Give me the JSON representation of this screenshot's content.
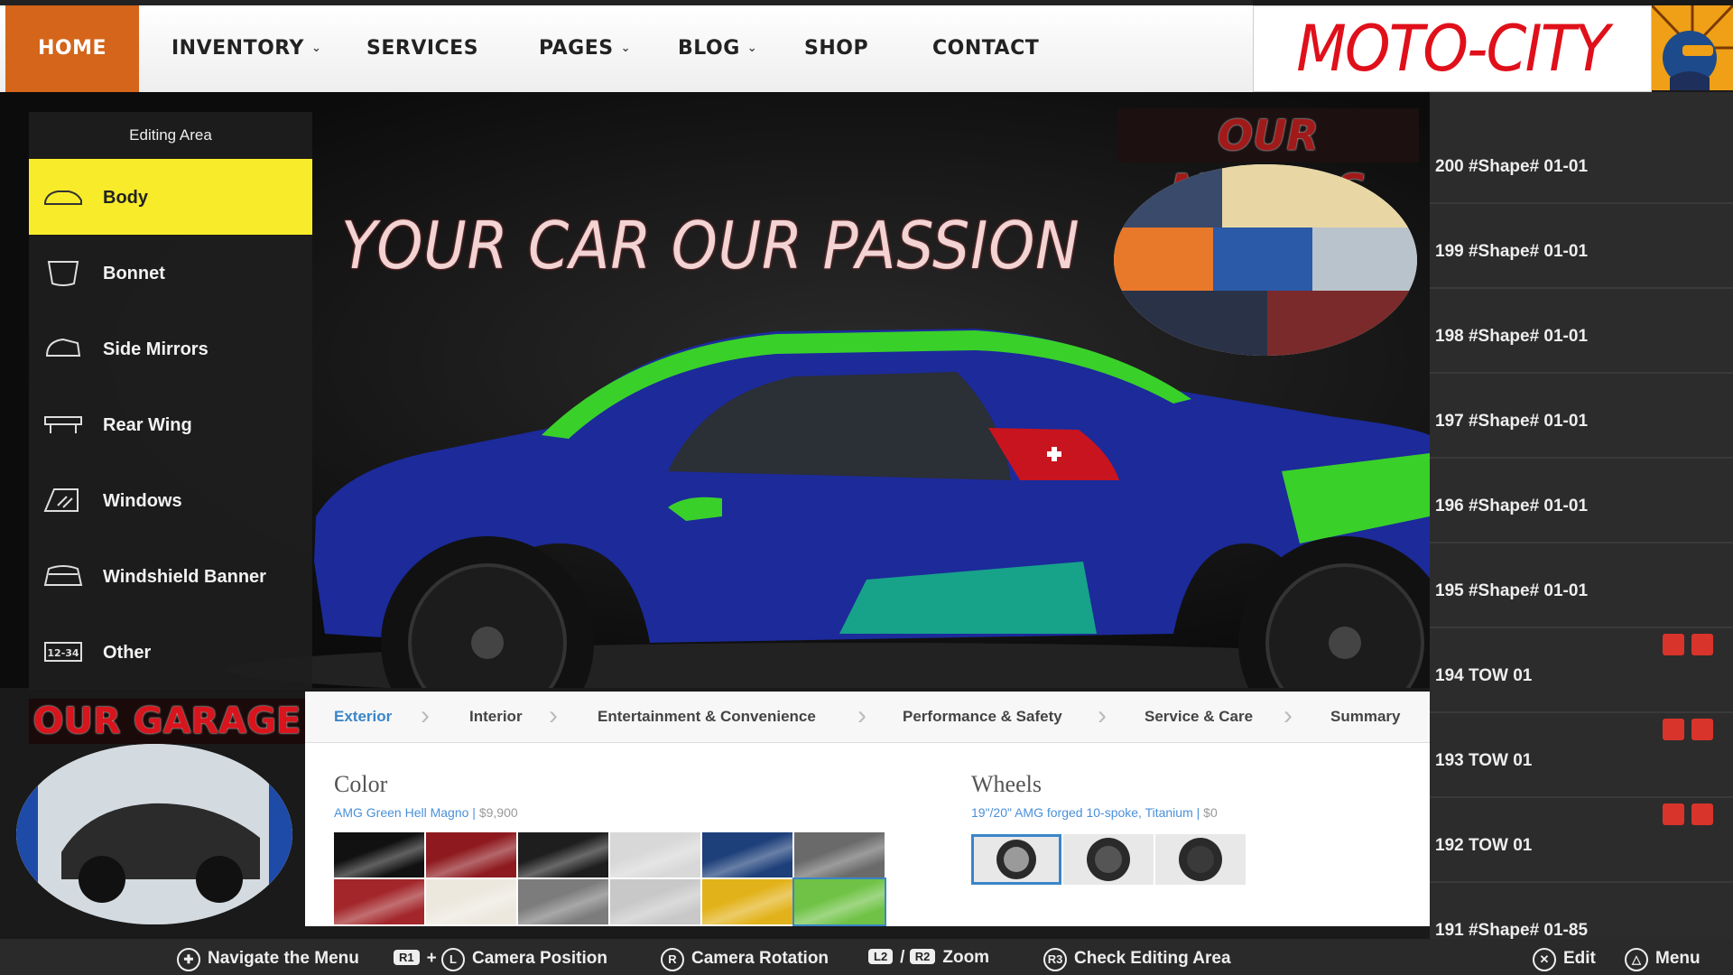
{
  "nav": {
    "items": [
      {
        "label": "HOME",
        "dropdown": false
      },
      {
        "label": "INVENTORY",
        "dropdown": true
      },
      {
        "label": "SERVICES",
        "dropdown": false
      },
      {
        "label": "PAGES",
        "dropdown": true
      },
      {
        "label": "BLOG",
        "dropdown": true
      },
      {
        "label": "SHOP",
        "dropdown": false
      },
      {
        "label": "CONTACT",
        "dropdown": false
      }
    ],
    "active": "HOME"
  },
  "brand": {
    "logo_text": "MOTO-CITY",
    "accent": "#d4651a",
    "logo_color": "#e0101a"
  },
  "hero": {
    "tagline": "YOUR CAR OUR PASSION"
  },
  "editing_area": {
    "title": "Editing Area",
    "items": [
      {
        "label": "Body",
        "icon": "car-body-icon",
        "active": true
      },
      {
        "label": "Bonnet",
        "icon": "bonnet-icon",
        "active": false
      },
      {
        "label": "Side Mirrors",
        "icon": "side-mirror-icon",
        "active": false
      },
      {
        "label": "Rear Wing",
        "icon": "rear-wing-icon",
        "active": false
      },
      {
        "label": "Windows",
        "icon": "window-icon",
        "active": false
      },
      {
        "label": "Windshield Banner",
        "icon": "windshield-banner-icon",
        "active": false
      },
      {
        "label": "Other",
        "icon": "number-plate-icon",
        "active": false
      }
    ],
    "highlight_color": "#f8ec2a"
  },
  "models": {
    "title": "OUR MODELS"
  },
  "garage": {
    "title": "OUR GARAGE"
  },
  "layers": {
    "rows": [
      {
        "text": "200 #Shape# 01-01",
        "has_actions": false
      },
      {
        "text": "199 #Shape# 01-01",
        "has_actions": false
      },
      {
        "text": "198 #Shape# 01-01",
        "has_actions": false
      },
      {
        "text": "197 #Shape# 01-01",
        "has_actions": false
      },
      {
        "text": "196 #Shape# 01-01",
        "has_actions": false
      },
      {
        "text": "195 #Shape# 01-01",
        "has_actions": false
      },
      {
        "text": "194 TOW 01",
        "has_actions": true
      },
      {
        "text": "193 TOW 01",
        "has_actions": true
      },
      {
        "text": "192 TOW 01",
        "has_actions": true
      },
      {
        "text": "191 #Shape# 01-85",
        "has_actions": false
      }
    ]
  },
  "config": {
    "tabs": [
      "Exterior",
      "Interior",
      "Entertainment & Convenience",
      "Performance & Safety",
      "Service & Care",
      "Summary"
    ],
    "active_tab": "Exterior",
    "color": {
      "heading": "Color",
      "selected": "AMG Green Hell Magno",
      "price": "$9,900",
      "swatches": [
        "#111111",
        "#8e1a1f",
        "#1e1e1e",
        "#d8d8d8",
        "#1d3f7a",
        "#6a6a6a",
        "#a2262a",
        "#ece8de",
        "#7c7c7c",
        "#c8c8c8",
        "#e2b21a",
        "#6fc245"
      ]
    },
    "wheels": {
      "heading": "Wheels",
      "selected": "19\"/20\" AMG forged 10-spoke, Titanium",
      "price": "$0"
    }
  },
  "hints": [
    {
      "key": "dpad",
      "label": "Navigate the Menu"
    },
    {
      "key": "R1 + L",
      "label": "Camera Position"
    },
    {
      "key": "R",
      "label": "Camera Rotation"
    },
    {
      "key": "L2 / R2",
      "label": "Zoom"
    },
    {
      "key": "R3",
      "label": "Check Editing Area"
    },
    {
      "key": "X",
      "label": "Edit"
    },
    {
      "key": "△",
      "label": "Menu"
    }
  ]
}
